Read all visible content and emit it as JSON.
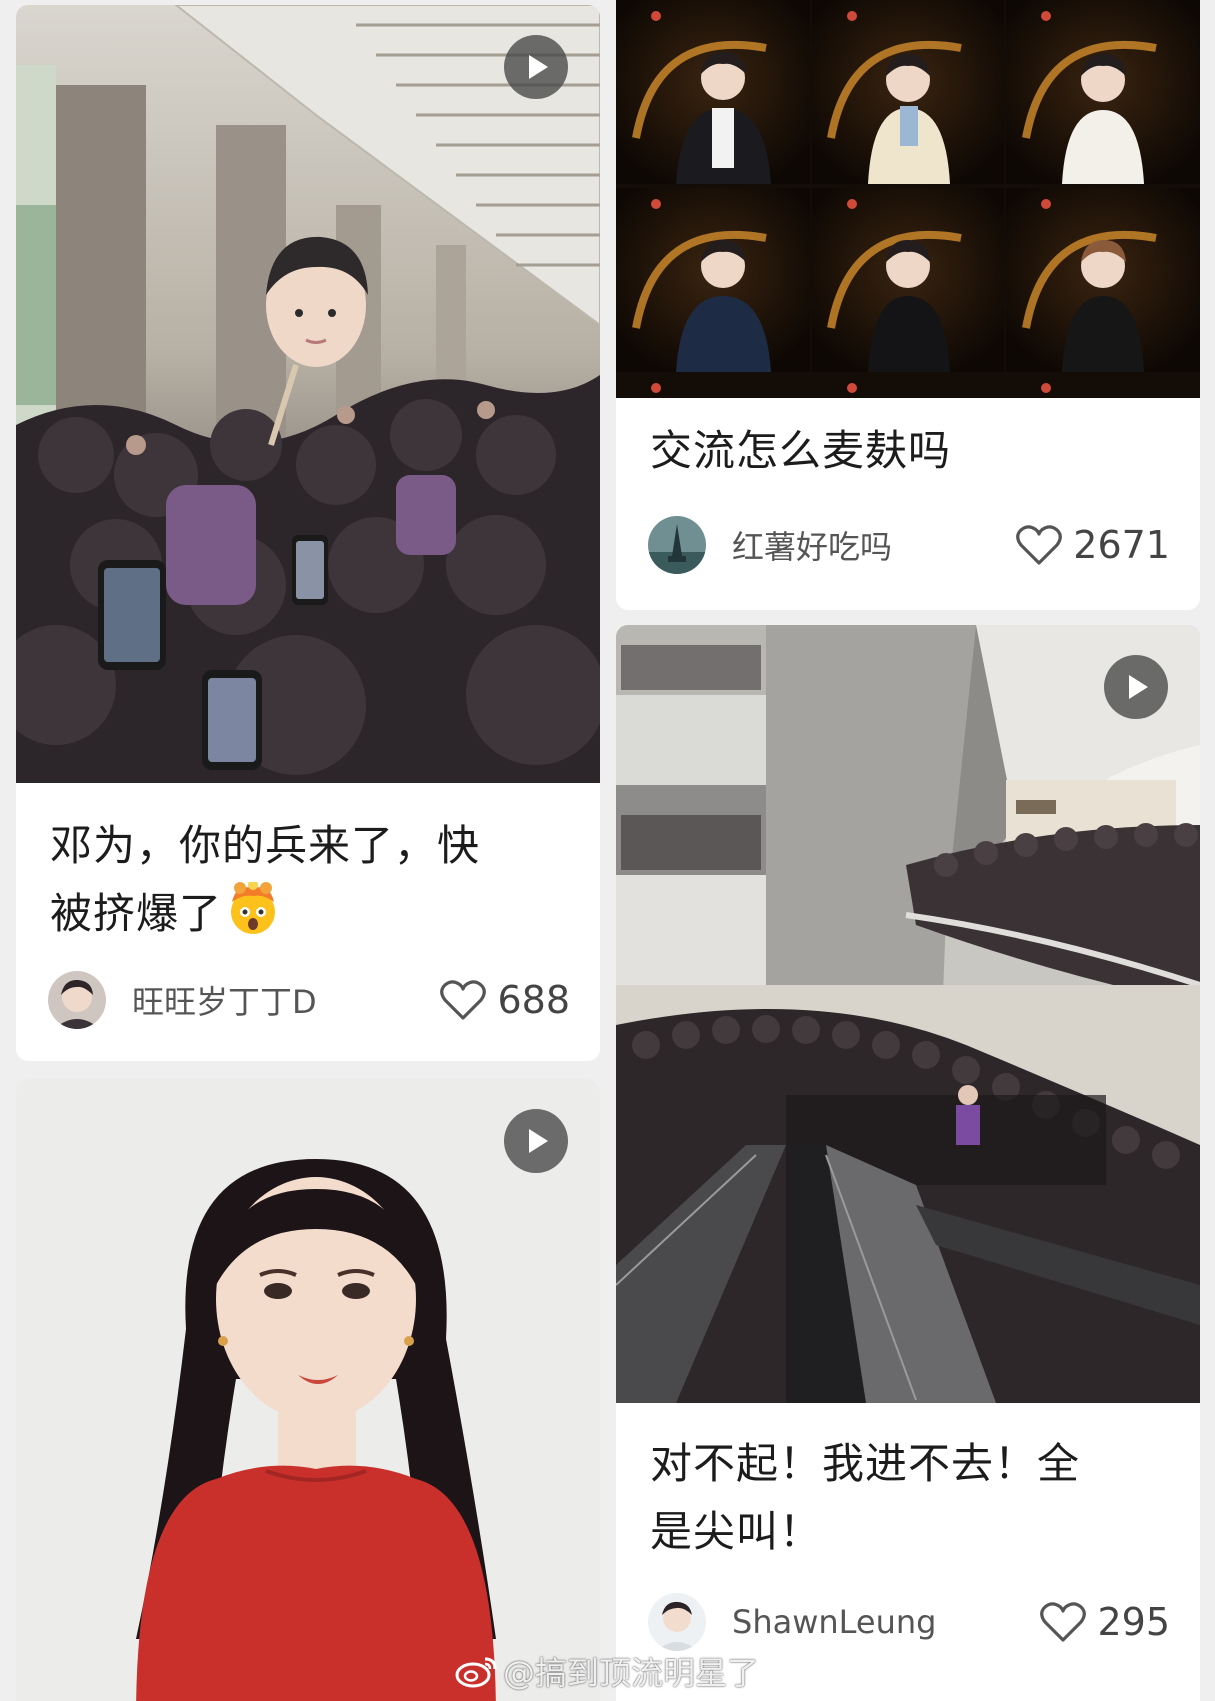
{
  "feed": {
    "posts": [
      {
        "title_line1": "邓为，你的兵来了，快",
        "title_line2": "被挤爆了",
        "emoji_icon": "exploding-head-emoji",
        "username": "旺旺岁丁丁D",
        "likes": "688",
        "has_video": true
      },
      {
        "title": "交流怎么麦麸吗",
        "username": "红薯好吃吗",
        "likes": "2671",
        "has_video": false
      },
      {
        "has_video": true
      },
      {
        "title_line1": "对不起！我进不去！全",
        "title_line2": "是尖叫！",
        "username": "ShawnLeung",
        "likes": "295",
        "has_video": true
      }
    ]
  },
  "watermark": {
    "text": "@搞到顶流明星了",
    "icon": "weibo-logo-icon"
  },
  "colors": {
    "background": "#efefef",
    "card": "#ffffff",
    "accent_red": "#c9302c",
    "gold": "#c8862a"
  }
}
